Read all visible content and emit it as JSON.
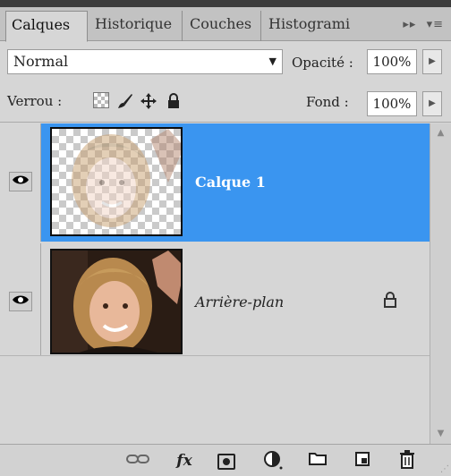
{
  "tabs": [
    {
      "label": "Calques",
      "active": true
    },
    {
      "label": "Historique"
    },
    {
      "label": "Couches"
    },
    {
      "label": "Histogrami"
    }
  ],
  "tab_extras": {
    "more": "▸▸",
    "menu": "▾≡"
  },
  "blend": {
    "mode": "Normal",
    "opacity_label": "Opacité :",
    "opacity_value": "100%"
  },
  "lock": {
    "label": "Verrou :",
    "fill_label": "Fond :",
    "fill_value": "100%"
  },
  "layers": [
    {
      "name": "Calque 1",
      "selected": true,
      "visible": true
    },
    {
      "name": "Arrière-plan",
      "selected": false,
      "visible": true,
      "locked": true
    }
  ],
  "icons": {
    "eye": "eye-icon",
    "lock": "lock-icon",
    "link": "link-icon",
    "fx": "fx",
    "mask": "mask-icon",
    "adjustment": "adjustment-icon",
    "group": "folder-icon",
    "new_layer": "new-layer-icon",
    "trash": "trash-icon"
  },
  "colors": {
    "selected_layer": "#3a95f0",
    "panel_bg": "#d6d6d6"
  }
}
